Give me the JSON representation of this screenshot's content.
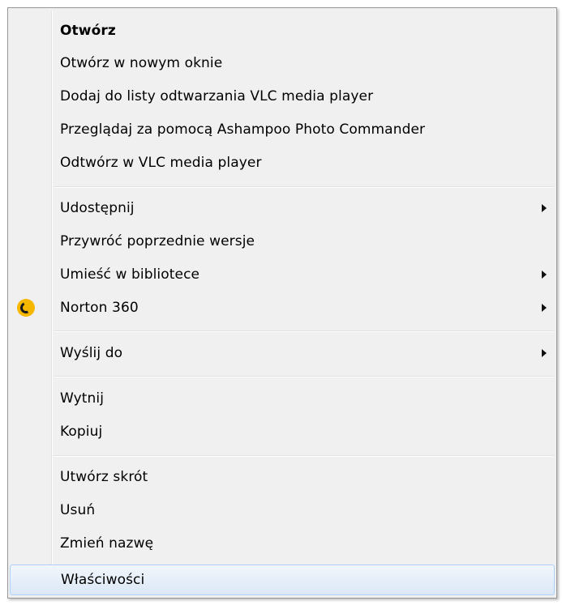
{
  "context_menu": {
    "groups": [
      {
        "items": [
          {
            "label": "Otwórz",
            "bold": true
          },
          {
            "label": "Otwórz w nowym oknie"
          },
          {
            "label": "Dodaj do listy odtwarzania VLC media player"
          },
          {
            "label": "Przeglądaj za pomocą Ashampoo Photo Commander"
          },
          {
            "label": "Odtwórz w VLC media player"
          }
        ]
      },
      {
        "items": [
          {
            "label": "Udostępnij",
            "submenu": true
          },
          {
            "label": "Przywróć poprzednie wersje"
          },
          {
            "label": "Umieść w bibliotece",
            "submenu": true
          },
          {
            "label": "Norton 360",
            "submenu": true,
            "icon": "norton-icon"
          }
        ]
      },
      {
        "items": [
          {
            "label": "Wyślij do",
            "submenu": true
          }
        ]
      },
      {
        "items": [
          {
            "label": "Wytnij"
          },
          {
            "label": "Kopiuj"
          }
        ]
      },
      {
        "items": [
          {
            "label": "Utwórz skrót"
          },
          {
            "label": "Usuń"
          },
          {
            "label": "Zmień nazwę"
          }
        ]
      },
      {
        "items": [
          {
            "label": "Właściwości",
            "highlighted": true
          }
        ]
      }
    ],
    "colors": {
      "background": "#f0f0f0",
      "border": "#979797",
      "highlight": "#dbe8f6",
      "highlight_border": "#aecff7",
      "norton_icon": "#f5b700"
    }
  }
}
